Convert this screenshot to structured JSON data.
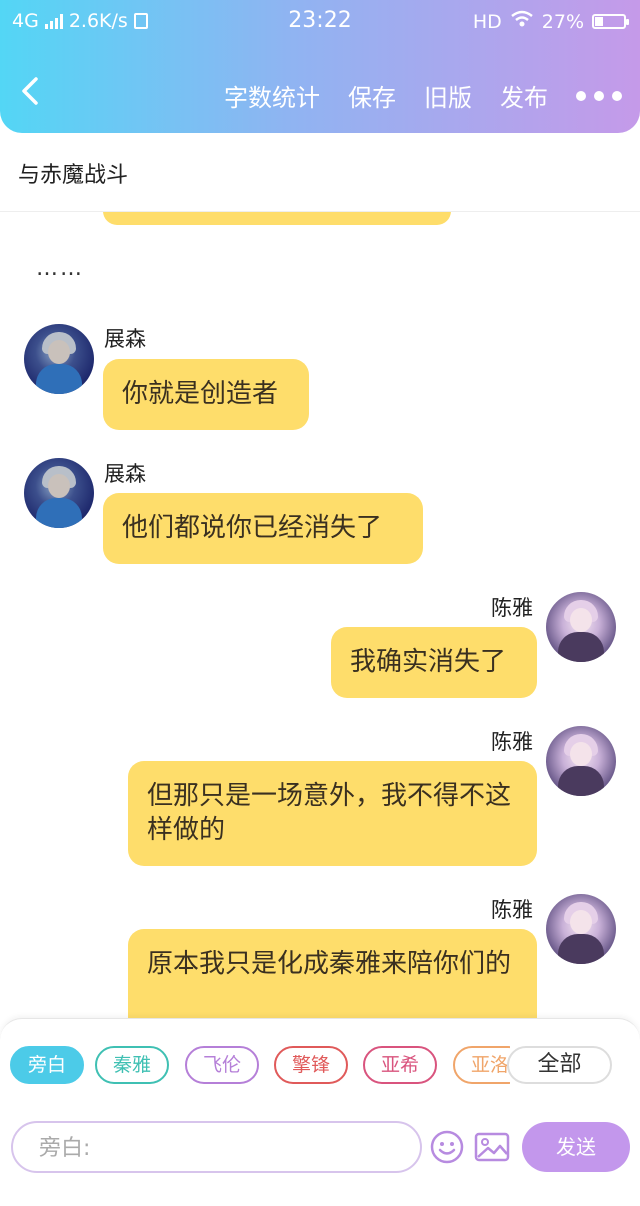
{
  "status_bar": {
    "network": "4G",
    "speed": "2.6K/s",
    "time": "23:22",
    "hd": "HD",
    "battery_percent": "27%",
    "battery_level": 0.27
  },
  "header": {
    "actions": {
      "word_count": "字数统计",
      "save": "保存",
      "old_version": "旧版",
      "publish": "发布"
    }
  },
  "title": "与赤魔战斗",
  "narration": "……",
  "messages": [
    {
      "name": "展森",
      "text": "你就是创造者",
      "side": "left"
    },
    {
      "name": "展森",
      "text": "他们都说你已经消失了",
      "side": "left"
    },
    {
      "name": "陈雅",
      "text": "我确实消失了",
      "side": "right"
    },
    {
      "name": "陈雅",
      "text": "但那只是一场意外，我不得不这样做的",
      "side": "right"
    },
    {
      "name": "陈雅",
      "text": "原本我只是化成秦雅来陪你们的",
      "side": "right"
    }
  ],
  "character_chips": [
    {
      "label": "旁白",
      "color": "#4ccbe8",
      "active": true
    },
    {
      "label": "秦雅",
      "color": "#3fc0b3",
      "active": false
    },
    {
      "label": "飞伦",
      "color": "#b57fd8",
      "active": false
    },
    {
      "label": "擎锋",
      "color": "#e05a5a",
      "active": false
    },
    {
      "label": "亚希",
      "color": "#d9547e",
      "active": false
    },
    {
      "label": "亚洛",
      "color": "#f0a56a",
      "active": false
    }
  ],
  "all_button": "全部",
  "composer": {
    "placeholder": "旁白:",
    "send_label": "发送"
  },
  "colors": {
    "bubble": "#fedd6b",
    "send": "#c397ec",
    "header_start": "#53d6f5",
    "header_end": "#c59ae9"
  }
}
